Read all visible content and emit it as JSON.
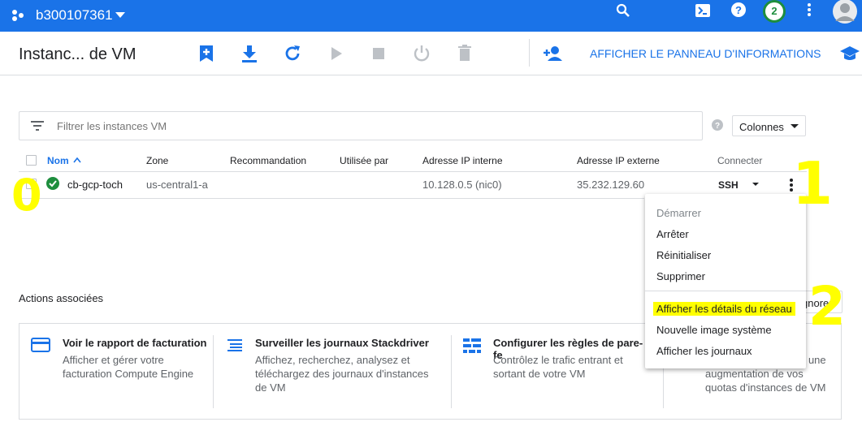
{
  "topbar": {
    "project": "b300107361",
    "notif_count": "2"
  },
  "header": {
    "title": "Instanc... de VM",
    "info_panel_label": "AFFICHER LE PANNEAU D'INFORMATIONS"
  },
  "filter": {
    "placeholder": "Filtrer les instances VM",
    "columns_label": "Colonnes"
  },
  "table": {
    "headers": {
      "nom": "Nom",
      "zone": "Zone",
      "recommandation": "Recommandation",
      "utilisee_par": "Utilisée par",
      "ip_interne": "Adresse IP interne",
      "ip_externe": "Adresse IP externe",
      "connecter": "Connecter"
    },
    "row": {
      "name": "cb-gcp-toch",
      "zone": "us-central1-a",
      "ip_interne": "10.128.0.5 (nic0)",
      "ip_externe": "35.232.129.60",
      "connect": "SSH"
    }
  },
  "menu": {
    "items": [
      "Démarrer",
      "Arrêter",
      "Réinitialiser",
      "Supprimer",
      "Afficher les détails du réseau",
      "Nouvelle image système",
      "Afficher les journaux"
    ]
  },
  "related": {
    "title": "Actions associées",
    "ignore_label": "gnorer",
    "cards": [
      {
        "title": "Voir le rapport de facturation",
        "desc1": "Afficher et gérer votre",
        "desc2": "facturation Compute Engine"
      },
      {
        "title": "Surveiller les journaux Stackdriver",
        "desc1": "Affichez, recherchez, analysez et",
        "desc2": "téléchargez des journaux d'instances",
        "desc3": "de VM"
      },
      {
        "title": "Configurer les règles de pare-fe",
        "desc1": "Contrôlez le trafic entrant et",
        "desc2": "sortant de votre VM"
      },
      {
        "desc1": "r une",
        "desc2": "augmentation de vos",
        "desc3": "quotas d'instances de VM"
      }
    ]
  },
  "annotations": {
    "one": "1",
    "two": "2",
    "zero": "0"
  },
  "colors": {
    "brand": "#1a73e8",
    "highlight": "#ffff00",
    "success": "#1e8e3e"
  }
}
